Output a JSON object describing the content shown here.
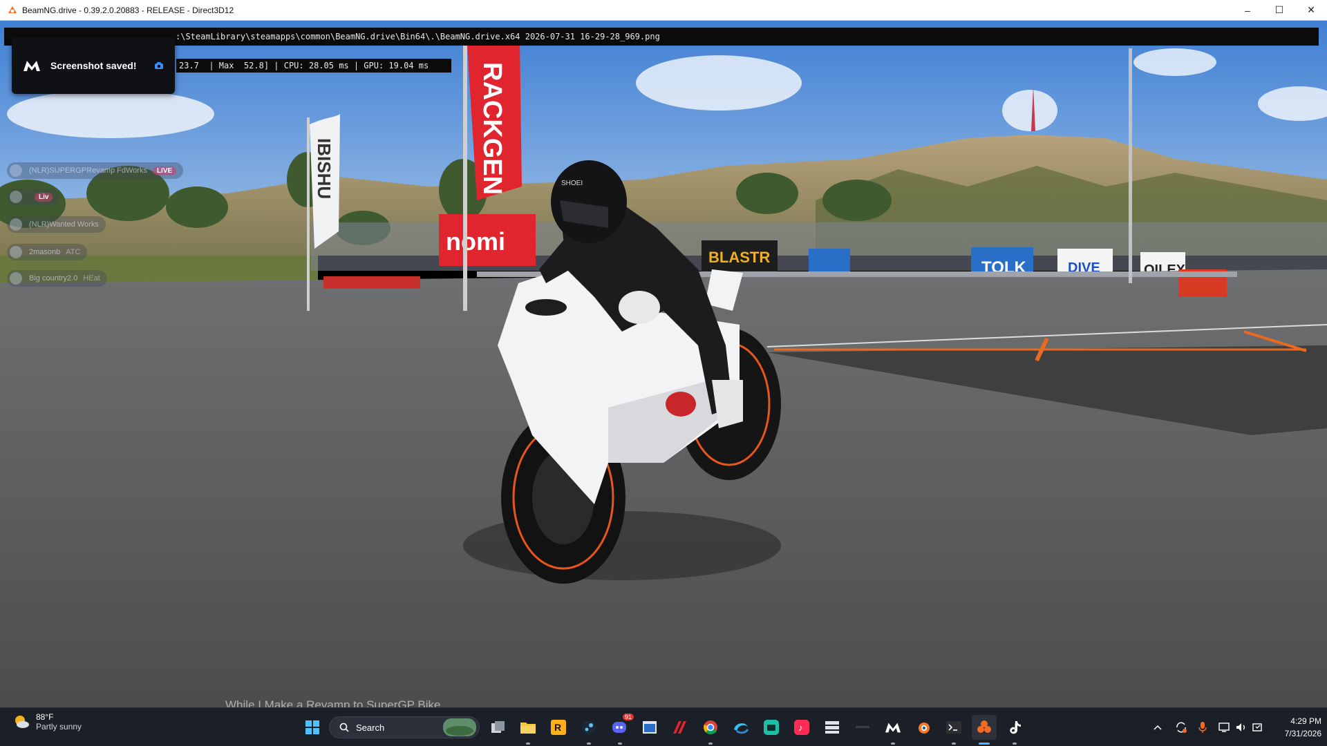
{
  "window": {
    "title": "BeamNG.drive - 0.39.2.0.20883 - RELEASE - Direct3D12",
    "controls": {
      "minimize": "–",
      "maximize": "☐",
      "close": "✕"
    }
  },
  "console": {
    "line1": ":\\SteamLibrary\\steamapps\\common\\BeamNG.drive\\Bin64\\.\\BeamNG.drive.x64 2026-07-31 16-29-28_969.png",
    "line2": "23.7  | Max  52.8] | CPU: 28.05 ms | GPU: 19.04 ms"
  },
  "toast": {
    "text": "Screenshot saved!",
    "icon": "camera-icon"
  },
  "multiplayer": {
    "players": [
      {
        "name": "(NLR)SUPERGPRevamp FdWorks",
        "badge": "LIVE",
        "tag": ""
      },
      {
        "name": "",
        "badge": "Liv",
        "tag": ""
      },
      {
        "name": "(NLR)Wanted Works",
        "badge": "",
        "tag": ""
      },
      {
        "name": "2masonb",
        "badge": "",
        "tag": "ATC"
      },
      {
        "name": "Big country2.0",
        "badge": "",
        "tag": "HEat"
      }
    ]
  },
  "scene": {
    "banners": {
      "red_flag": "RACKGEN",
      "white_flag": "IBISHU",
      "red_board": "nomi",
      "sponsor_1": "BLASTR",
      "sponsor_2": "TOLK",
      "sponsor_3": "OILEX",
      "sponsor_4": "DIVE"
    },
    "helmet_brand": "SHOEI"
  },
  "caption": "While I Make a Revamp to SuperGP Bike",
  "taskbar": {
    "weather": {
      "temp": "88°F",
      "desc": "Partly sunny"
    },
    "search": {
      "label": "Search"
    },
    "icons": [
      "windows-start-icon",
      "task-view-icon",
      "file-explorer-icon",
      "rockstar-icon",
      "steam-icon",
      "discord-icon",
      "app-window-icon",
      "racing-app-icon",
      "chrome-icon",
      "edge-icon",
      "game-app-icon",
      "tiktok-studio-icon",
      "server-app-icon",
      "beamng-taskbar-icon",
      "blender-icon",
      "terminal-icon",
      "obs-like-icon",
      "tiktok-icon"
    ],
    "discord_badge": "91",
    "clock": {
      "time": "4:29 PM",
      "date": "7/31/2026"
    }
  },
  "colors": {
    "sky": "#5f93d8",
    "asphalt": "#5b5b5d",
    "bike_body": "#f2f3f5",
    "accent_red": "#e0252e",
    "taskbar_bg": "#1b1f27"
  }
}
